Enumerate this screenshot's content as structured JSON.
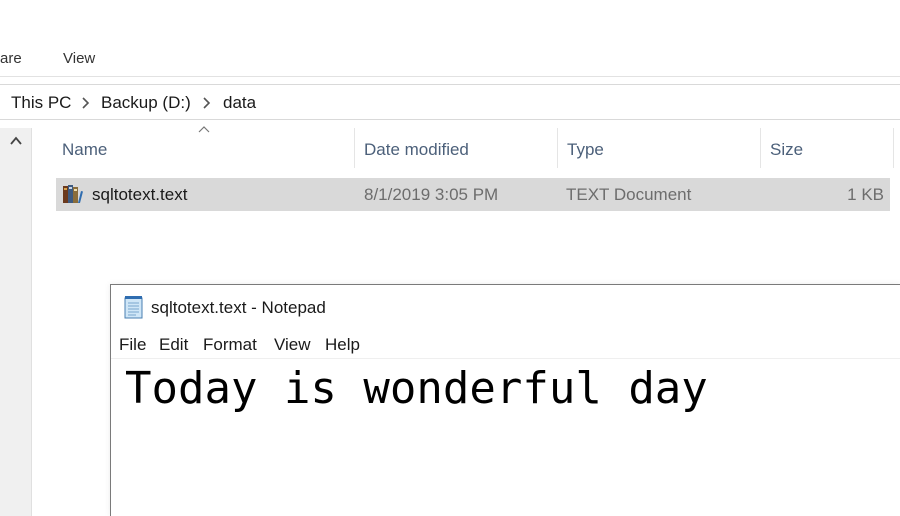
{
  "explorer": {
    "ribbon": {
      "tabs": [
        "are",
        "View"
      ]
    },
    "address": {
      "crumbs": [
        "This PC",
        "Backup (D:)",
        "data"
      ]
    },
    "columns": {
      "name": "Name",
      "date": "Date modified",
      "type": "Type",
      "size": "Size"
    },
    "files": [
      {
        "name": "sqltotext.text",
        "date": "8/1/2019 3:05 PM",
        "type": "TEXT Document",
        "size": "1 KB",
        "icon": "text-file-icon"
      }
    ]
  },
  "notepad": {
    "title": "sqltotext.text - Notepad",
    "menu": [
      "File",
      "Edit",
      "Format",
      "View",
      "Help"
    ],
    "content": "Today is wonderful day"
  },
  "colors": {
    "selection": "#d9d9d9",
    "header_text": "#4c607a",
    "muted_text": "#6d6d6d"
  }
}
